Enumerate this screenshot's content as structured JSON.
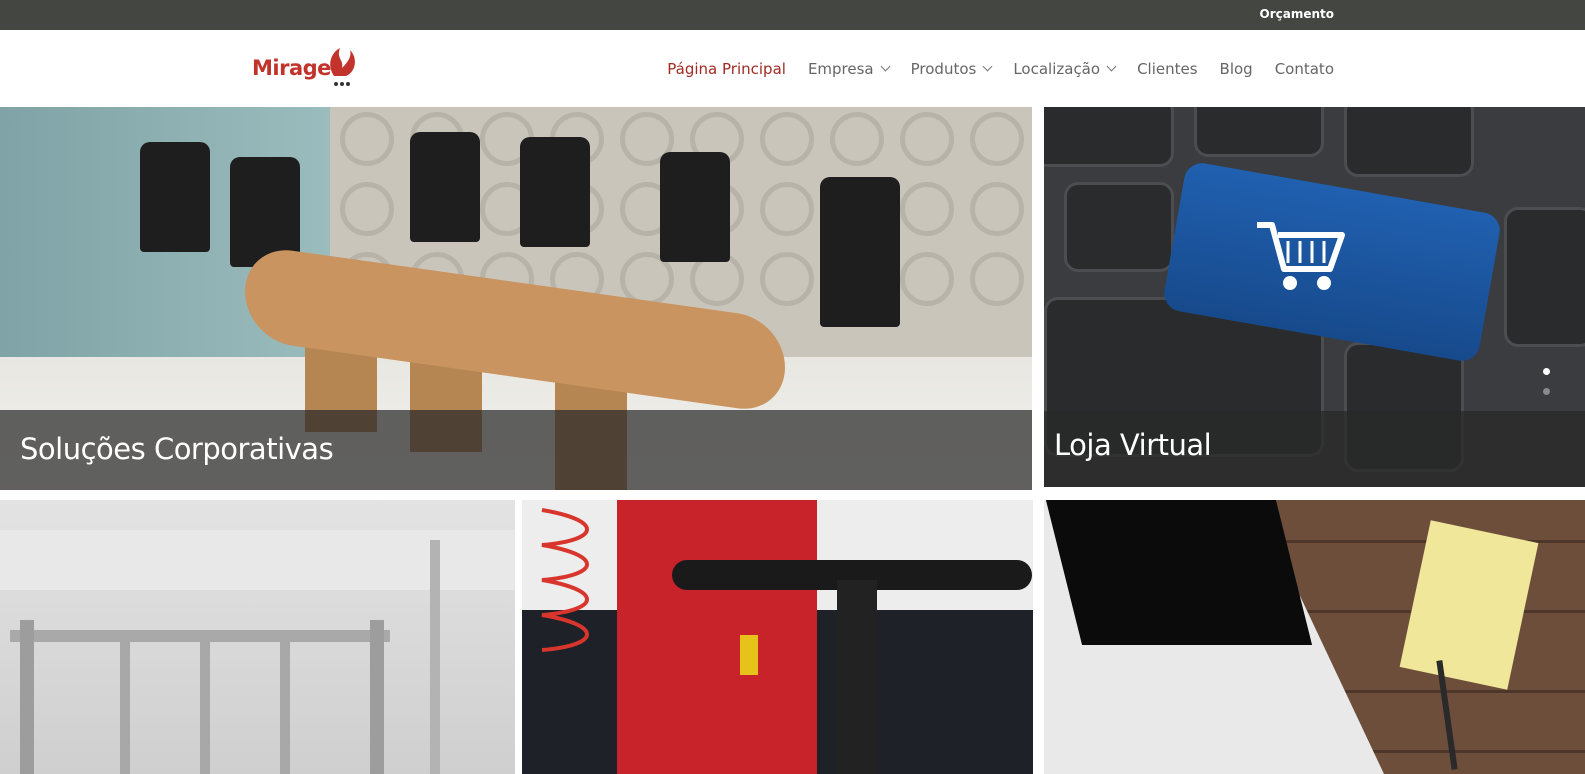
{
  "topbar": {
    "quote_label": "Orçamento"
  },
  "brand": {
    "logo_text": "Mirage",
    "accent_color": "#c2332b"
  },
  "nav": {
    "items": [
      {
        "label": "Página Principal",
        "active": true,
        "has_dropdown": false
      },
      {
        "label": "Empresa",
        "active": false,
        "has_dropdown": true
      },
      {
        "label": "Produtos",
        "active": false,
        "has_dropdown": true
      },
      {
        "label": "Localização",
        "active": false,
        "has_dropdown": true
      },
      {
        "label": "Clientes",
        "active": false,
        "has_dropdown": false
      },
      {
        "label": "Blog",
        "active": false,
        "has_dropdown": false
      },
      {
        "label": "Contato",
        "active": false,
        "has_dropdown": false
      }
    ]
  },
  "tiles": {
    "corporate": {
      "caption": "Soluções Corporativas"
    },
    "store": {
      "caption": "Loja Virtual"
    }
  },
  "slider": {
    "dot_count": 2,
    "active_index": 0
  }
}
